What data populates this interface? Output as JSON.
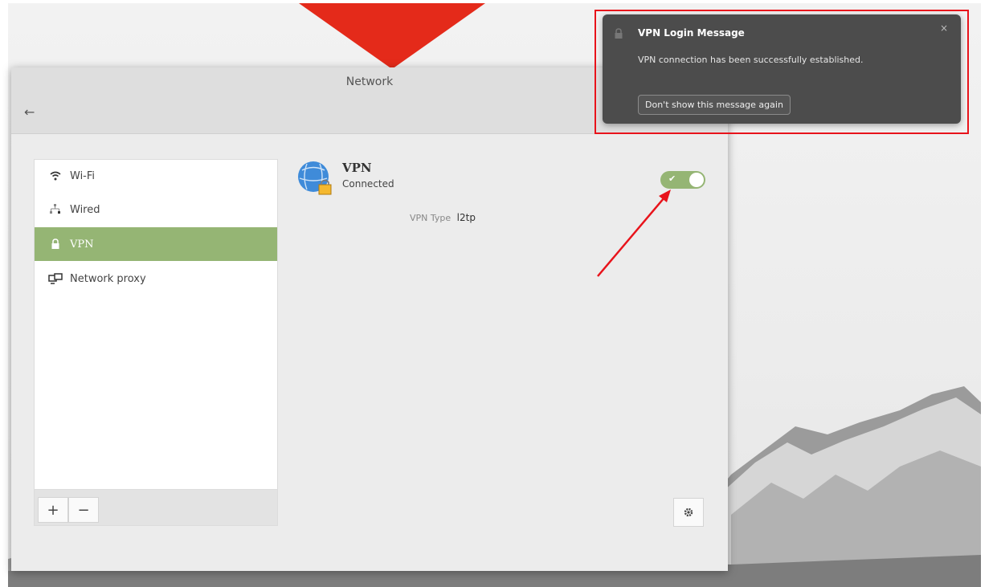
{
  "window": {
    "title": "Network"
  },
  "sidebar": {
    "items": [
      {
        "label": "Wi-Fi",
        "icon": "wifi-icon"
      },
      {
        "label": "Wired",
        "icon": "wired-network-icon"
      },
      {
        "label": "VPN",
        "icon": "vpn-lock-icon",
        "selected": true
      },
      {
        "label": "Network proxy",
        "icon": "network-proxy-icon"
      }
    ],
    "add_label": "+",
    "remove_label": "−"
  },
  "vpn": {
    "name": "VPN",
    "status": "Connected",
    "type_label": "VPN Type",
    "type_value": "l2tp",
    "enabled": true
  },
  "notification": {
    "title": "VPN Login Message",
    "body": "VPN connection has been successfully established.",
    "button": "Don't show this message again",
    "close": "×"
  },
  "colors": {
    "accent": "#95b574",
    "highlight": "#e8131b",
    "notification_bg": "#4c4c4c"
  }
}
